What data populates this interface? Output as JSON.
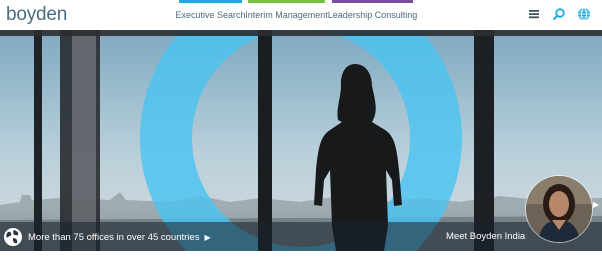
{
  "brand": {
    "logo_text": "boyden"
  },
  "nav": {
    "items": [
      {
        "label": "Executive Search",
        "color": "#1fa9e1"
      },
      {
        "label": "Interim Management",
        "color": "#7ac143"
      },
      {
        "label": "Leadership Consulting",
        "color": "#7b4fa0"
      }
    ]
  },
  "header_icons": [
    "menu-icon",
    "search-icon",
    "globe-icon"
  ],
  "accent": {
    "icon_blue": "#1fa9e1",
    "ring_blue": "#4cc3f0"
  },
  "hero": {
    "offices_text": "More than 75 offices in over 45 countries",
    "offices_arrow": "▶",
    "meet_text": "Meet Boyden India",
    "play_arrow": "▶"
  }
}
